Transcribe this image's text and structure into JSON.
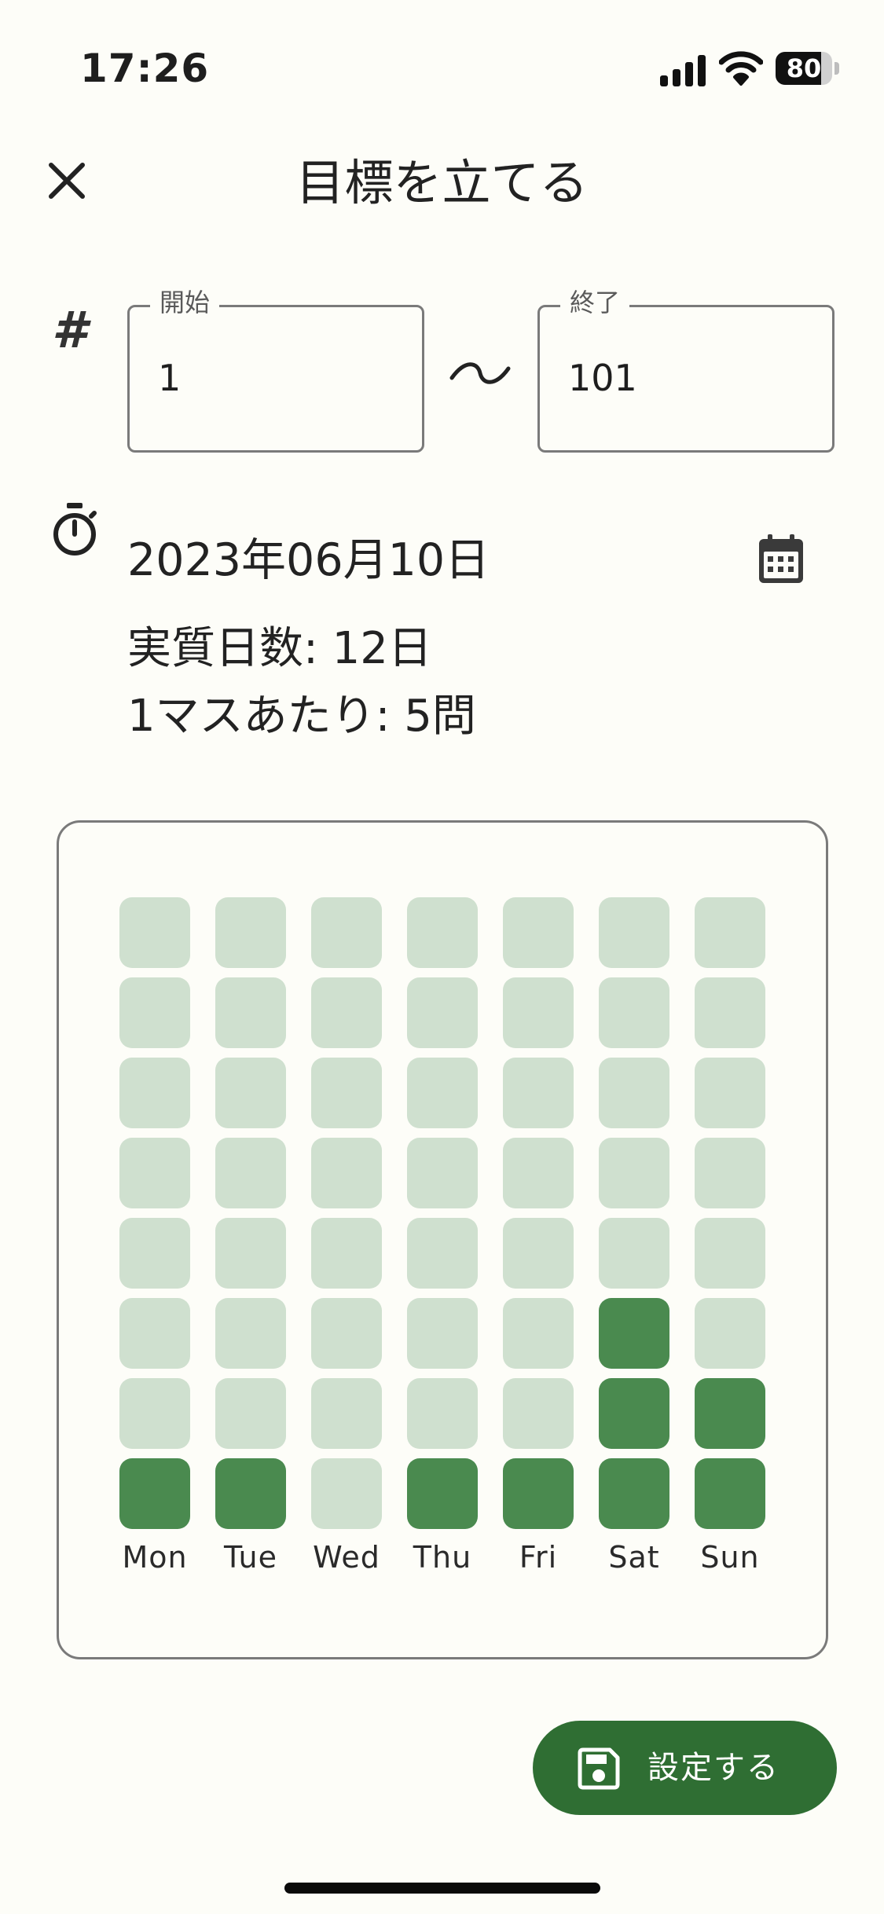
{
  "status_bar": {
    "time": "17:26",
    "battery": "80",
    "battery_level": 0.8,
    "icons": [
      "signal-icon",
      "wifi-icon",
      "battery-icon"
    ]
  },
  "header": {
    "title": "目標を立てる",
    "close_icon": "close-icon"
  },
  "range": {
    "hash_symbol": "#",
    "start_label": "開始",
    "start_value": "1",
    "end_label": "終了",
    "end_value": "101"
  },
  "deadline": {
    "date": "2023年06月10日",
    "timer_icon": "timer-icon",
    "calendar_icon": "calendar-icon"
  },
  "stats": {
    "days_text": "実質日数: 12日",
    "per_cell_text": "1マスあたり: 5問"
  },
  "grid": {
    "days": [
      "Mon",
      "Tue",
      "Wed",
      "Thu",
      "Fri",
      "Sat",
      "Sun"
    ],
    "done_counts": [
      1,
      1,
      0,
      1,
      1,
      3,
      2
    ],
    "rows": 8,
    "colors": {
      "empty": "#cfe0cf",
      "done": "#4a8a4f"
    }
  },
  "actions": {
    "save_label": "設定する",
    "save_icon": "save-icon",
    "button_color": "#2f6e33"
  }
}
